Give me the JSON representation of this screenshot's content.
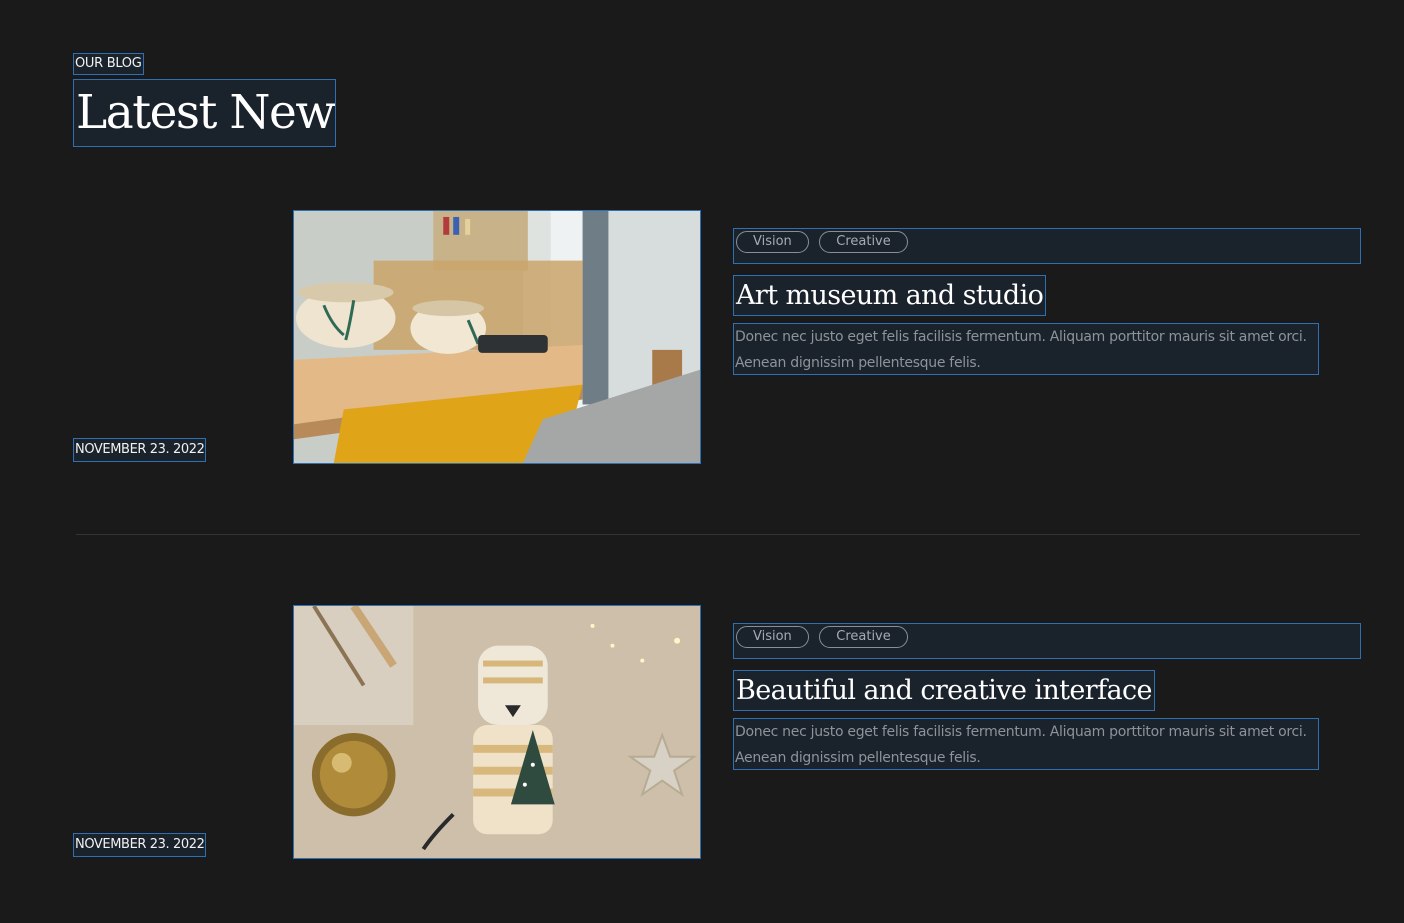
{
  "section": {
    "eyebrow": "OUR BLOG",
    "title": "Latest News"
  },
  "articles": [
    {
      "date": "NOVEMBER 23. 2022",
      "tags": [
        "Vision",
        "Creative"
      ],
      "title": "Art museum and studio",
      "excerpt": "Donec nec justo eget felis facilisis fermentum. Aliquam porttitor mauris sit amet orci. Aenean dignissim pellentesque felis."
    },
    {
      "date": "NOVEMBER 23. 2022",
      "tags": [
        "Vision",
        "Creative"
      ],
      "title": "Beautiful and creative interface",
      "excerpt": "Donec nec justo eget felis facilisis fermentum. Aliquam porttitor mauris sit amet orci. Aenean dignissim pellentesque felis."
    }
  ],
  "colors": {
    "background": "#1a1a1b",
    "outline": "#2f6fb3",
    "muted_text": "#8f9399"
  }
}
